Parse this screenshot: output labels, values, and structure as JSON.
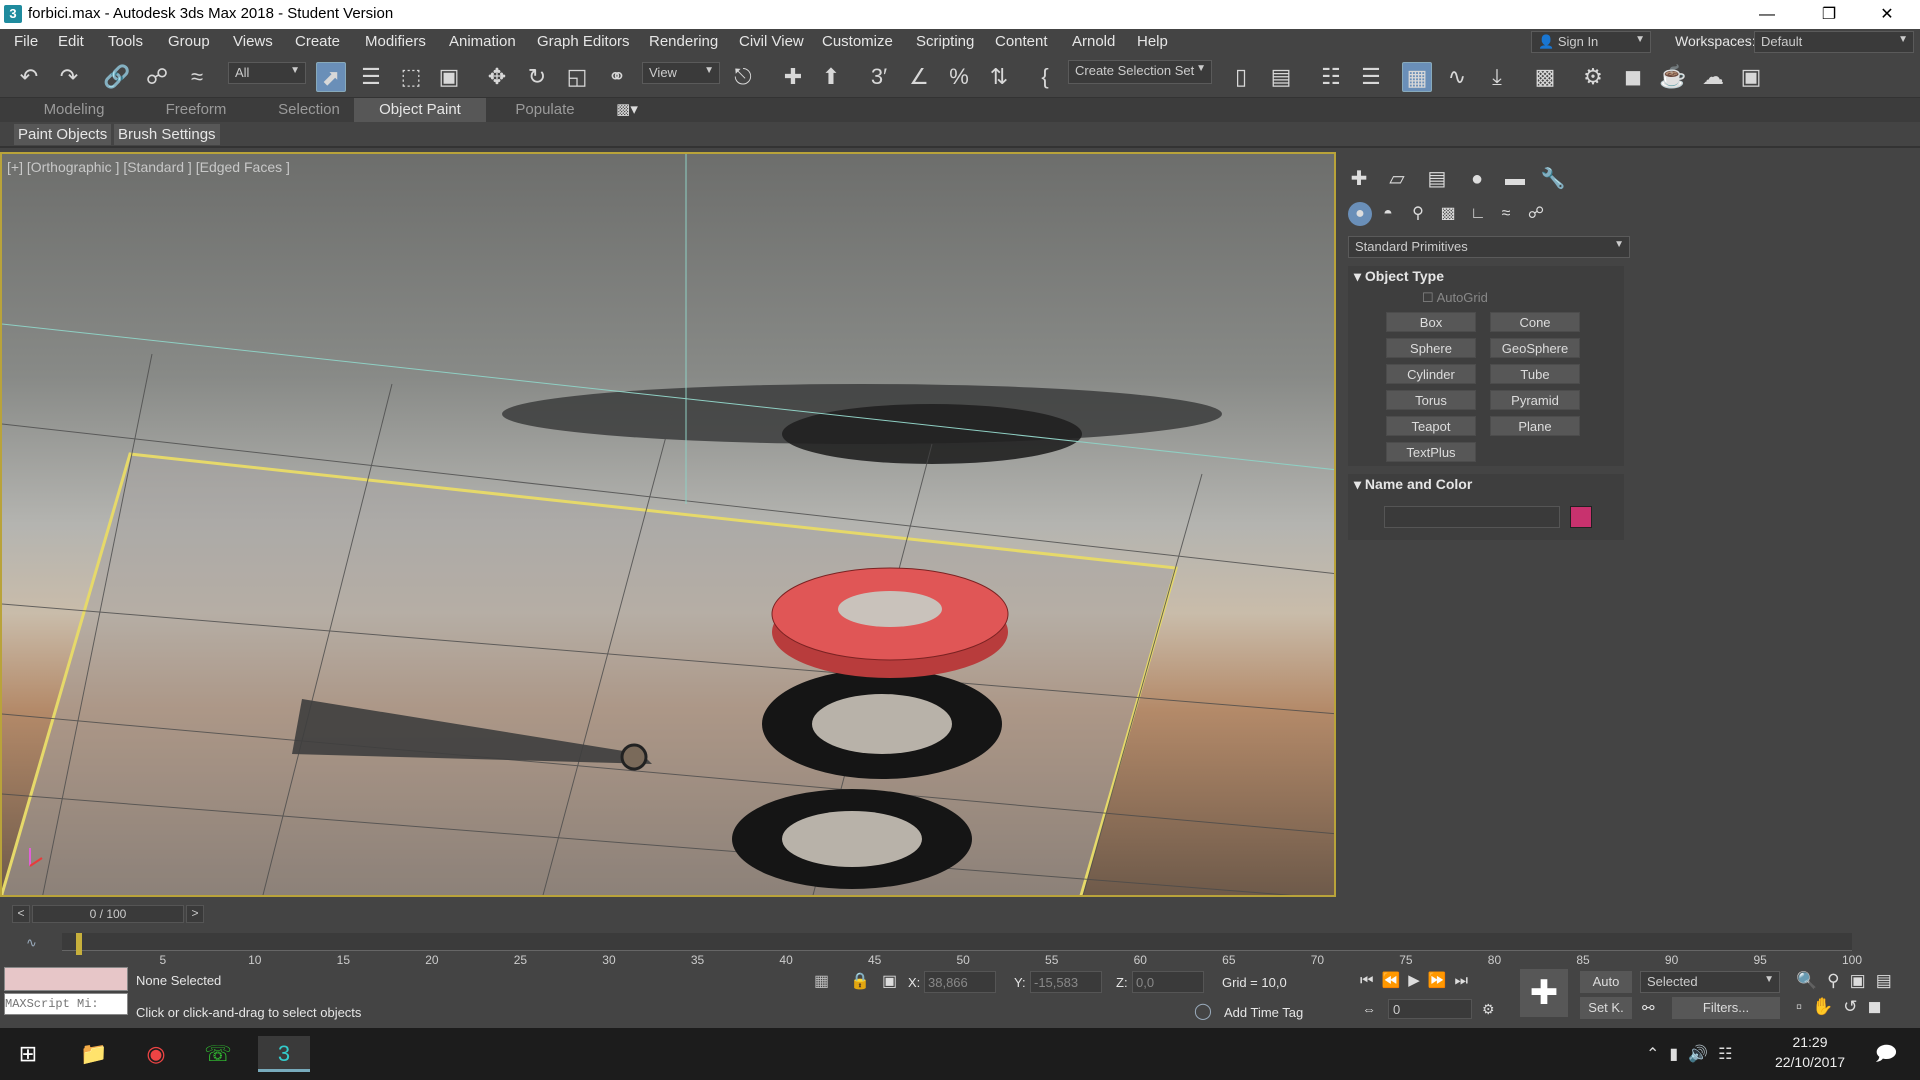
{
  "window": {
    "title": "forbici.max - Autodesk 3ds Max 2018 - Student Version",
    "app_icon_glyph": "3",
    "buttons": [
      "minimize",
      "restore",
      "close"
    ]
  },
  "menu": {
    "items": [
      "File",
      "Edit",
      "Tools",
      "Group",
      "Views",
      "Create",
      "Modifiers",
      "Animation",
      "Graph Editors",
      "Rendering",
      "Civil View",
      "Customize",
      "Scripting",
      "Content",
      "Arnold",
      "Help"
    ],
    "sign_in": "Sign In",
    "workspaces_label": "Workspaces:",
    "workspaces_value": "Default"
  },
  "toolbar": {
    "filter_value": "All",
    "ref_coord_value": "View",
    "selection_set_placeholder": "Create Selection Set"
  },
  "ribbon": {
    "tabs": [
      "Modeling",
      "Freeform",
      "Selection",
      "Object Paint",
      "Populate"
    ],
    "active_tab": "Object Paint",
    "sub_buttons": [
      "Paint Objects",
      "Brush Settings"
    ]
  },
  "viewport": {
    "label": "[+] [Orthographic ] [Standard ] [Edged Faces ]"
  },
  "command_panel": {
    "category_value": "Standard Primitives",
    "object_type_title": "Object Type",
    "autogrid_label": "AutoGrid",
    "object_buttons": [
      "Box",
      "Cone",
      "Sphere",
      "GeoSphere",
      "Cylinder",
      "Tube",
      "Torus",
      "Pyramid",
      "Teapot",
      "Plane",
      "TextPlus"
    ],
    "name_color_title": "Name and Color",
    "name_value": "",
    "object_color": "#c8326e"
  },
  "timeline": {
    "frame_display": "0 / 100",
    "prev": "<",
    "next": ">",
    "ticks": [
      "5",
      "10",
      "15",
      "20",
      "25",
      "30",
      "35",
      "40",
      "45",
      "50",
      "55",
      "60",
      "65",
      "70",
      "75",
      "80",
      "85",
      "90",
      "95",
      "100"
    ]
  },
  "status": {
    "maxscript_placeholder": "MAXScript Mi:",
    "selection_status": "None Selected",
    "prompt": "Click or click-and-drag to select objects",
    "x_label": "X:",
    "x_value": "38,866",
    "y_label": "Y:",
    "y_value": "-15,583",
    "z_label": "Z:",
    "z_value": "0,0",
    "grid": "Grid = 10,0",
    "add_time_tag": "Add Time Tag",
    "auto_key": "Auto",
    "set_key": "Set K.",
    "key_filter_value": "Selected",
    "filters": "Filters...",
    "current_frame": "0"
  },
  "taskbar": {
    "time": "21:29",
    "date": "22/10/2017"
  }
}
